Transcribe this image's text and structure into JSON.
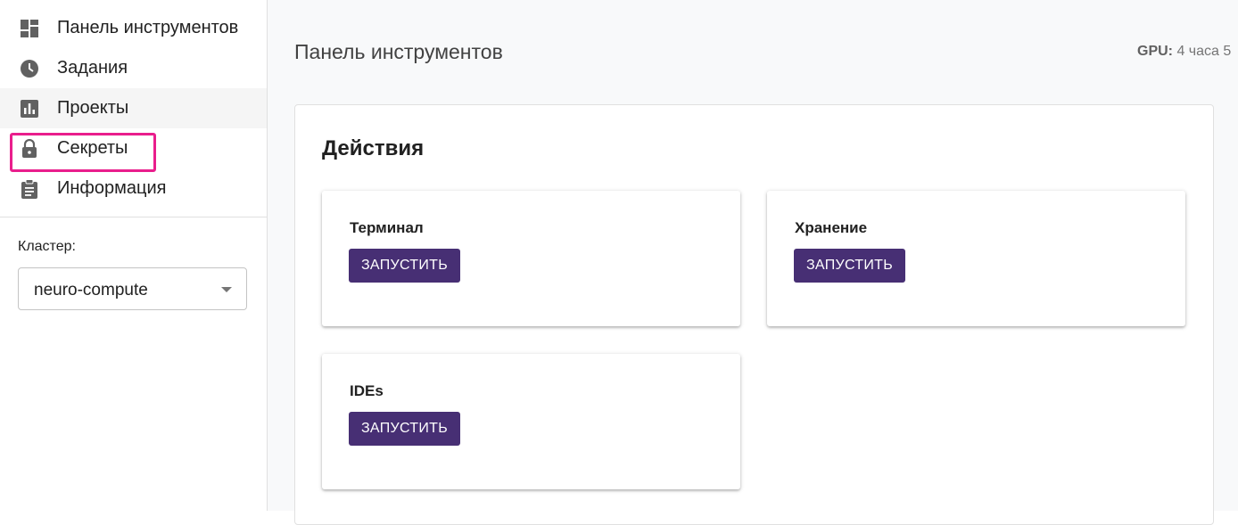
{
  "sidebar": {
    "items": [
      {
        "label": "Панель инструментов",
        "icon": "dashboard-icon"
      },
      {
        "label": "Задания",
        "icon": "clock-icon"
      },
      {
        "label": "Проекты",
        "icon": "bar-chart-icon"
      },
      {
        "label": "Секреты",
        "icon": "lock-icon"
      },
      {
        "label": "Информация",
        "icon": "clipboard-icon"
      }
    ],
    "cluster_label": "Кластер:",
    "cluster_value": "neuro-compute"
  },
  "header": {
    "title": "Панель инструментов",
    "gpu_label": "GPU:",
    "gpu_value": "4 часа 5"
  },
  "actions": {
    "title": "Действия",
    "cards": [
      {
        "title": "Терминал",
        "button": "ЗАПУСТИТЬ"
      },
      {
        "title": "Хранение",
        "button": "ЗАПУСТИТЬ"
      },
      {
        "title": "IDEs",
        "button": "ЗАПУСТИТЬ"
      }
    ]
  },
  "colors": {
    "accent": "#472f74",
    "highlight": "#e91e8c"
  }
}
